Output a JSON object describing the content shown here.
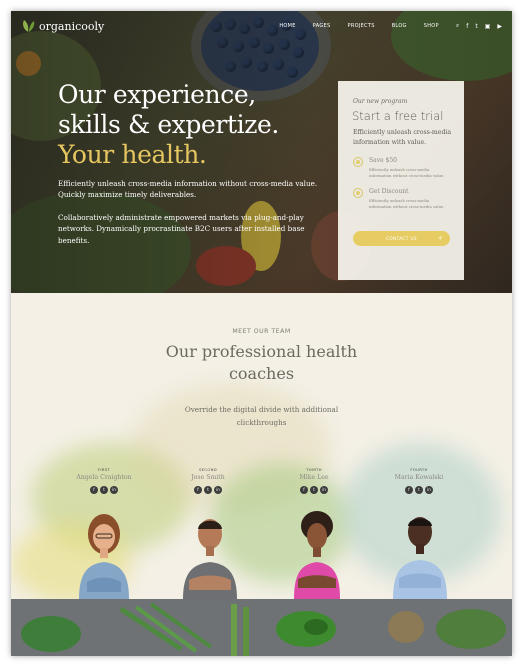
{
  "brand": {
    "name": "organicooly"
  },
  "nav": {
    "items": [
      "HOME",
      "PAGES",
      "PROJECTS",
      "BLOG",
      "SHOP"
    ],
    "icons": [
      "search-icon",
      "facebook-icon",
      "twitter-icon",
      "instagram-icon",
      "youtube-icon"
    ]
  },
  "hero": {
    "headline_1": "Our experience,",
    "headline_2": "skills & expertize.",
    "headline_3": "Your health.",
    "paragraph_1": "Efficiently unleash cross-media information without cross-media value. Quickly maximize timely deliverables.",
    "paragraph_2": "Collaboratively administrate empowered markets via plug-and-play networks. Dynamically procrastinate B2C users after installed base benefits."
  },
  "card": {
    "kicker": "Our new program",
    "title": "Start a free trial",
    "subtitle": "Efficiently unleash cross-media information with value.",
    "items": [
      {
        "label": "Save $50",
        "text": "Efficiently unleash cross-media information without cross-media value."
      },
      {
        "label": "Get Discount",
        "text": "Efficiently unleash cross-media information without cross-media value."
      }
    ],
    "button": "CONTACT US",
    "button_icon": "+"
  },
  "team": {
    "kicker": "MEET OUR TEAM",
    "title_1": "Our professional health",
    "title_2": "coaches",
    "desc_1": "Override the digital divide with additional",
    "desc_2": "clickthroughs",
    "members": [
      {
        "role": "FIRST",
        "name": "Angela Craighton"
      },
      {
        "role": "SECOND",
        "name": "Jose Smith"
      },
      {
        "role": "THIRTH",
        "name": "Mike Lee"
      },
      {
        "role": "FOURTH",
        "name": "Maria Kowalski"
      }
    ],
    "social_icons": [
      "f",
      "t",
      "in"
    ]
  },
  "colors": {
    "accent": "#e6cc62",
    "headline_yellow": "#e6c660",
    "team_bg": "#f4f0e6"
  }
}
